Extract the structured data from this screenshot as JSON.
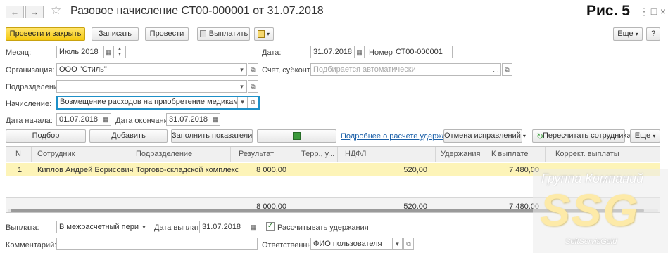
{
  "window": {
    "title": "Разовое начисление СТ00-000001 от 31.07.2018",
    "figure_label": "Рис. 5",
    "nav_back": "←",
    "nav_forward": "→",
    "star": "☆",
    "menu_icon": "⋮",
    "maximize_icon": "□",
    "close_icon": "×"
  },
  "toolbar": {
    "post_close": "Провести и закрыть",
    "save": "Записать",
    "post": "Провести",
    "pay": "Выплатить",
    "more": "Еще",
    "help": "?"
  },
  "form": {
    "month_label": "Месяц:",
    "month_value": "Июль 2018",
    "date_label": "Дата:",
    "date_value": "31.07.2018",
    "number_label": "Номер:",
    "number_value": "СТ00-000001",
    "org_label": "Организация:",
    "org_value": "ООО \"Стиль\"",
    "account_label": "Счет, субконто:",
    "account_placeholder": "Подбирается автоматически",
    "division_label": "Подразделение:",
    "division_value": "",
    "accrual_label": "Начисление:",
    "accrual_value": "Возмещение расходов на приобретение медикаментов",
    "start_label": "Дата начала:",
    "start_value": "01.07.2018",
    "end_label": "Дата окончания:",
    "end_value": "31.07.2018"
  },
  "table_toolbar": {
    "select": "Подбор",
    "add": "Добавить",
    "fill": "Заполнить показатели",
    "details_link": "Подробнее о расчете удержаний",
    "cancel_fix": "Отмена исправлений",
    "recalc": "Пересчитать сотрудника",
    "more": "Еще"
  },
  "table": {
    "columns": [
      "N",
      "Сотрудник",
      "Подразделение",
      "Результат",
      "Терр., у...",
      "НДФЛ",
      "Удержания",
      "К выплате",
      "Коррект. выплаты"
    ],
    "rows": [
      [
        "1",
        "Киплов Андрей Борисович",
        "Торгово-складской комплекс",
        "8 000,00",
        "",
        "520,00",
        "",
        "7 480,00",
        ""
      ]
    ],
    "totals": {
      "result": "8 000,00",
      "ndfl": "520,00",
      "pay": "7 480,00"
    }
  },
  "footer": {
    "payout_label": "Выплата:",
    "payout_value": "В межрасчетный период",
    "paydate_label": "Дата выплаты:",
    "paydate_value": "31.07.2018",
    "withhold_label": "Рассчитывать удержания",
    "comment_label": "Комментарий:",
    "comment_value": "",
    "responsible_label": "Ответственный:",
    "responsible_value": "ФИО пользователя"
  },
  "watermark": {
    "line1": "Группа Компаний",
    "line2": "SSG",
    "line3": "SoftServisGold"
  },
  "colors": {
    "primary_button": "#f5c90f",
    "selected_row": "#fdf4b8",
    "focus_border": "#1e90c8",
    "link": "#1a5fa8"
  }
}
